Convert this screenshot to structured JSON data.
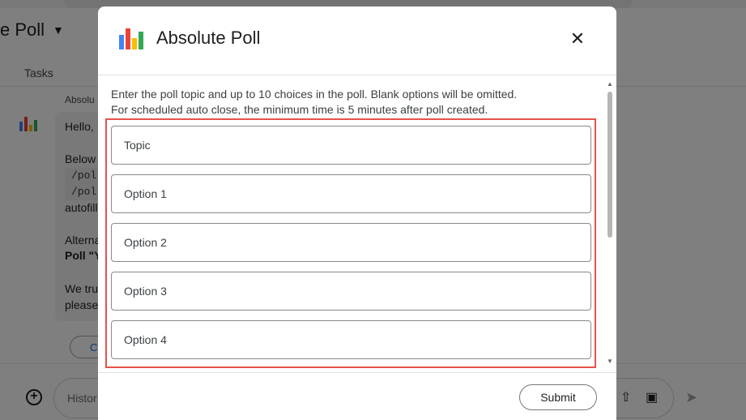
{
  "background": {
    "app_title": "e Poll",
    "tab_label": "Tasks",
    "sender_name": "Absolu",
    "message_lines": [
      "Hello, I",
      "Below",
      "autofill",
      "Alterna",
      "Poll \"Y",
      "We tru",
      "please"
    ],
    "code_snippets": [
      "/pol",
      "/pol"
    ],
    "action_button_label": "C",
    "compose_placeholder": "Histor"
  },
  "dialog": {
    "title": "Absolute Poll",
    "description_line1": "Enter the poll topic and up to 10 choices in the poll. Blank options will be omitted.",
    "description_line2": "For scheduled auto close, the minimum time is 5 minutes after poll created.",
    "fields": [
      {
        "placeholder": "Topic"
      },
      {
        "placeholder": "Option 1"
      },
      {
        "placeholder": "Option 2"
      },
      {
        "placeholder": "Option 3"
      },
      {
        "placeholder": "Option 4"
      }
    ],
    "submit_label": "Submit",
    "highlight_color": "#e8524a"
  },
  "icons": {
    "close": "close-icon",
    "logo": "poll-logo-icon",
    "add": "add-icon",
    "upload": "upload-icon",
    "video": "video-call-icon",
    "send": "send-icon"
  },
  "colors": {
    "logo_bars": [
      "#4285f4",
      "#ea4335",
      "#fbbc04",
      "#34a853"
    ],
    "overlay": "rgba(0,0,0,0.5)"
  }
}
